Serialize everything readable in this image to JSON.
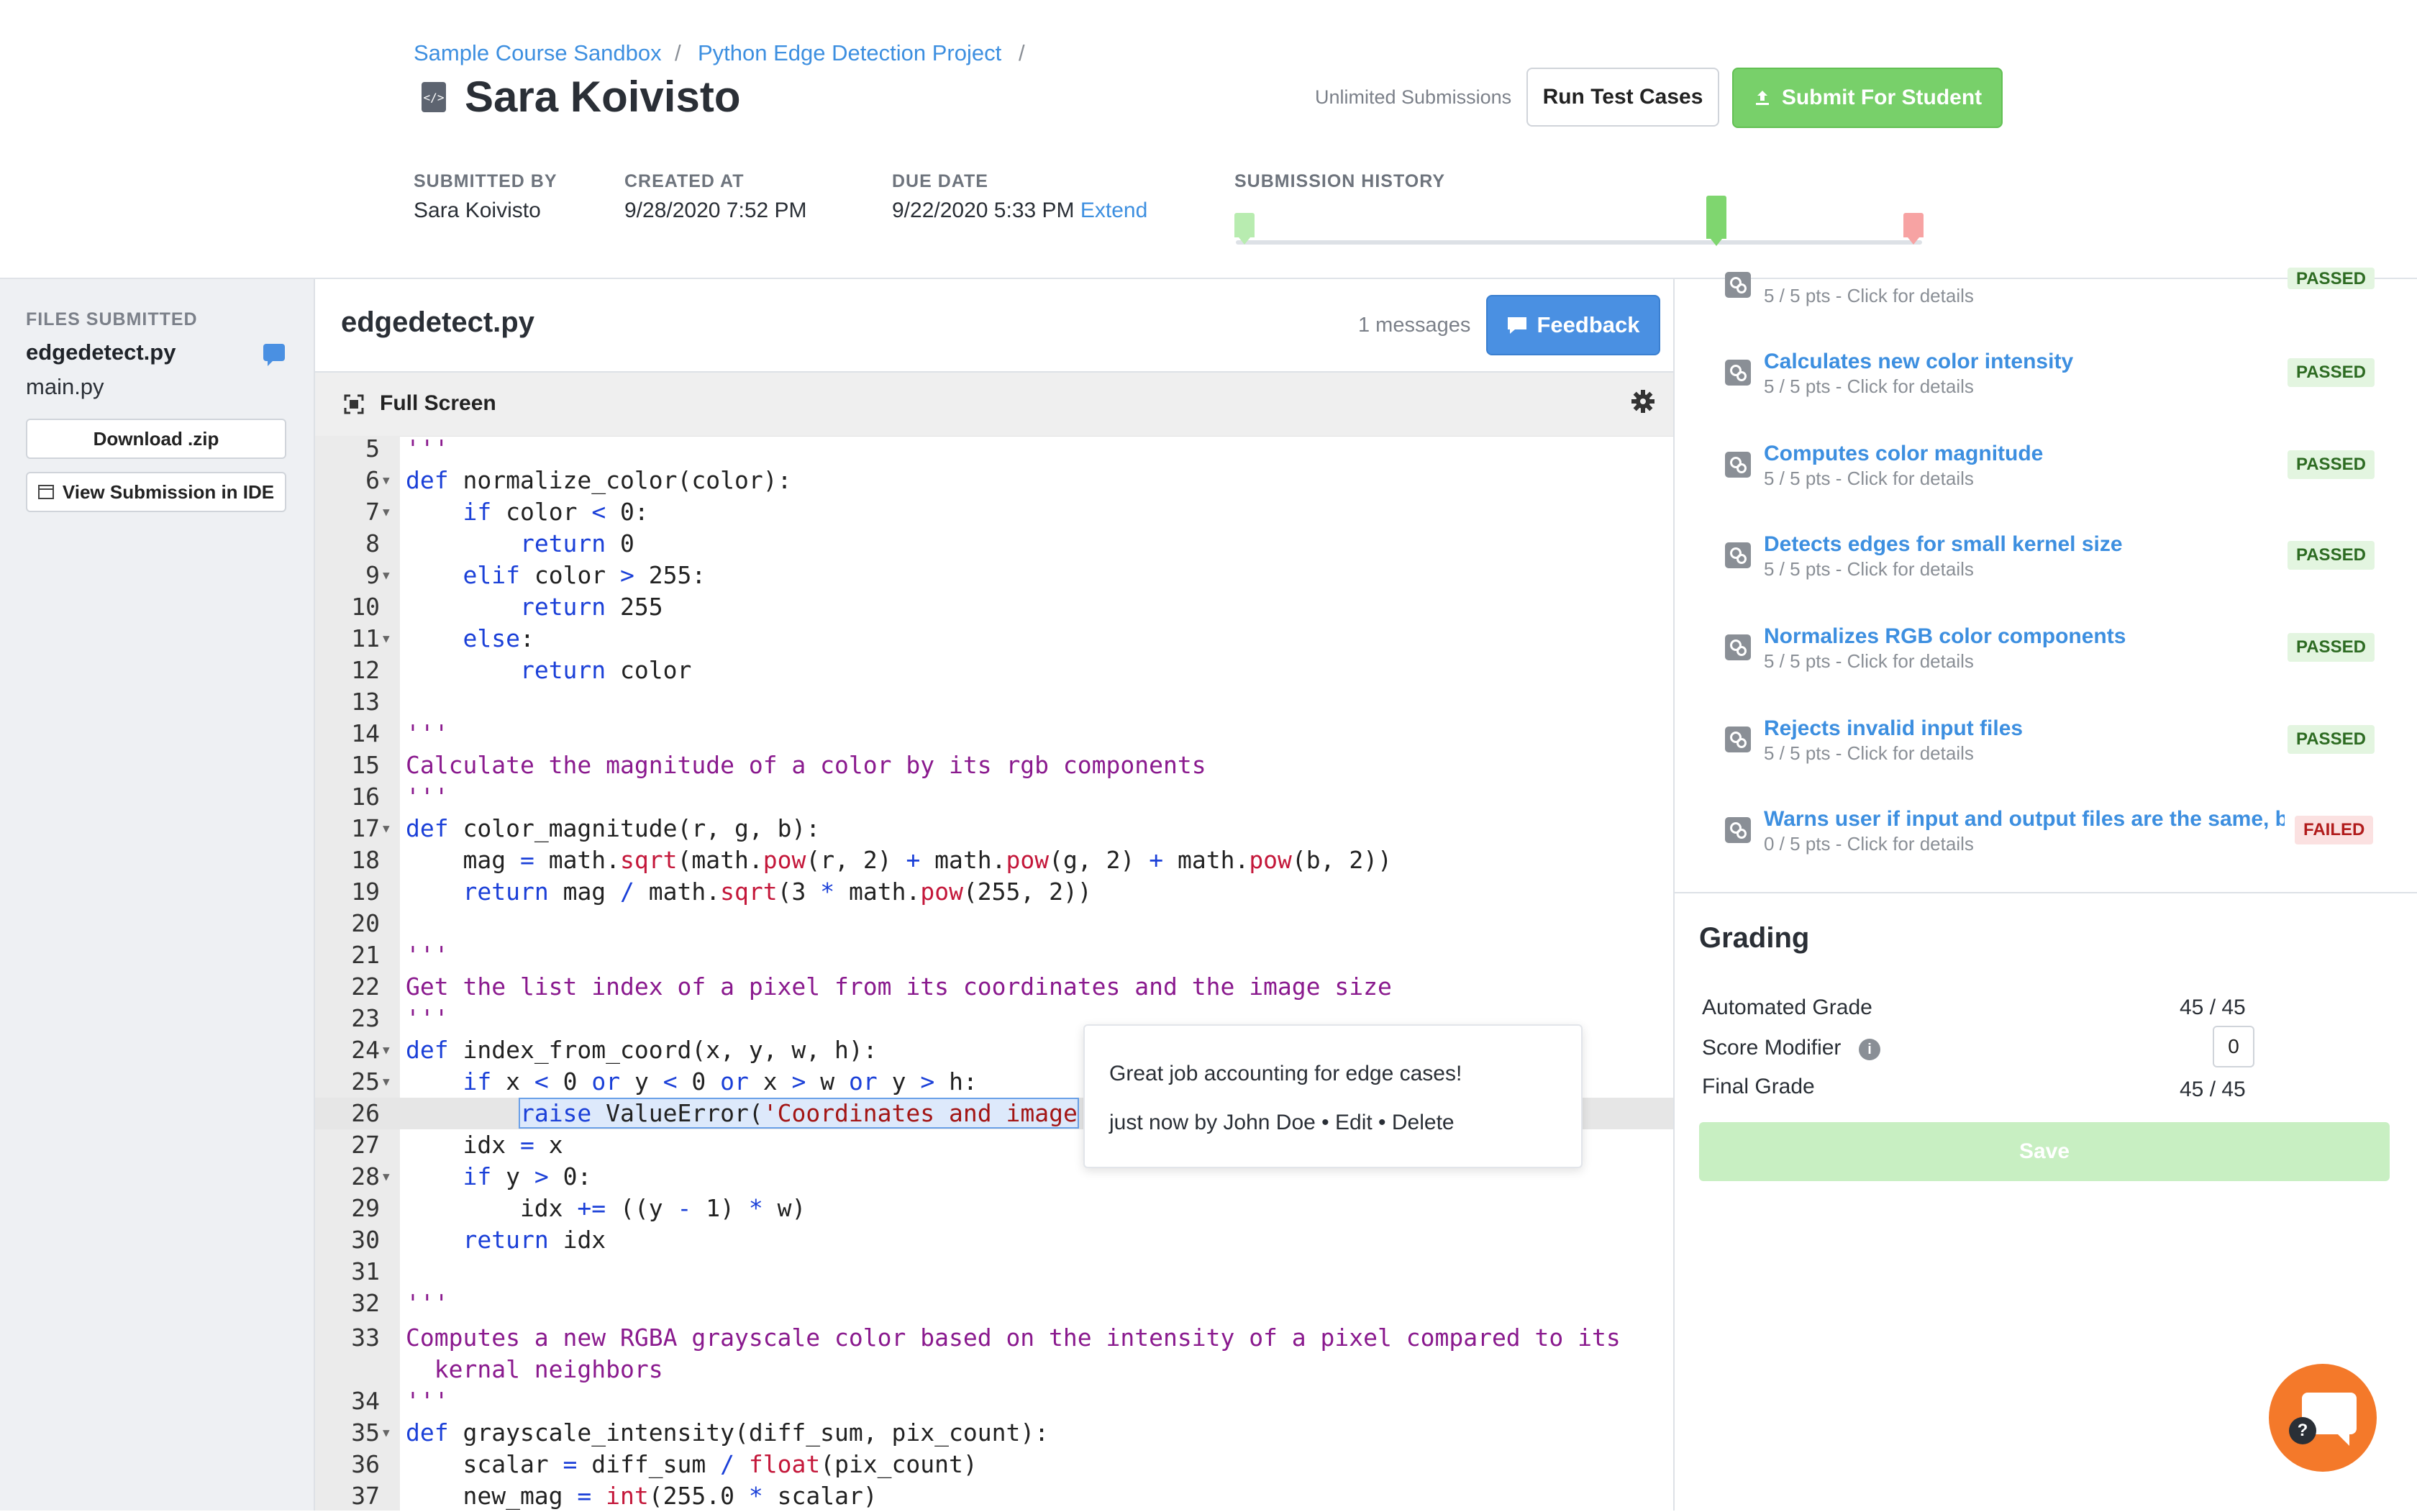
{
  "breadcrumb": {
    "course": "Sample Course Sandbox",
    "project": "Python Edge Detection Project",
    "separator": "/"
  },
  "header": {
    "student_name": "Sara Koivisto",
    "unlimited": "Unlimited Submissions",
    "run_tests_label": "Run Test Cases",
    "submit_label": "Submit For Student",
    "submitted_by_label": "SUBMITTED BY",
    "submitted_by_value": "Sara Koivisto",
    "created_at_label": "CREATED AT",
    "created_at_value": "9/28/2020 7:52 PM",
    "due_date_label": "DUE DATE",
    "due_date_value": "9/22/2020 5:33 PM",
    "extend_label": "Extend",
    "history_label": "SUBMISSION HISTORY"
  },
  "sidebar": {
    "files_label": "FILES SUBMITTED",
    "files": [
      "edgedetect.py",
      "main.py"
    ],
    "download_label": "Download .zip",
    "ide_label": "View Submission in IDE"
  },
  "editor": {
    "filename": "edgedetect.py",
    "messages": "1 messages",
    "feedback_label": "Feedback",
    "fullscreen_label": "Full Screen"
  },
  "popup": {
    "text": "Great job accounting for edge cases!",
    "meta": "just now by John Doe • Edit • Delete"
  },
  "tests": [
    {
      "title": "",
      "sub": "5 / 5 pts - Click for details",
      "status": "PASSED"
    },
    {
      "title": "Calculates new color intensity",
      "sub": "5 / 5 pts - Click for details",
      "status": "PASSED"
    },
    {
      "title": "Computes color magnitude",
      "sub": "5 / 5 pts - Click for details",
      "status": "PASSED"
    },
    {
      "title": "Detects edges for small kernel size",
      "sub": "5 / 5 pts - Click for details",
      "status": "PASSED"
    },
    {
      "title": "Normalizes RGB color components",
      "sub": "5 / 5 pts - Click for details",
      "status": "PASSED"
    },
    {
      "title": "Rejects invalid input files",
      "sub": "5 / 5 pts - Click for details",
      "status": "PASSED"
    },
    {
      "title": "Warns user if input and output files are the same, b",
      "sub": "0 / 5 pts - Click for details",
      "status": "FAILED"
    }
  ],
  "grading": {
    "title": "Grading",
    "automated_label": "Automated Grade",
    "automated_value": "45 / 45",
    "modifier_label": "Score Modifier",
    "modifier_value": "0",
    "final_label": "Final Grade",
    "final_value": "45 / 45",
    "save_label": "Save"
  },
  "colors": {
    "accent": "#3d8fe0",
    "submit_green": "#78d06a",
    "feedback_blue": "#4a90e2",
    "chat_orange": "#f4792a"
  }
}
